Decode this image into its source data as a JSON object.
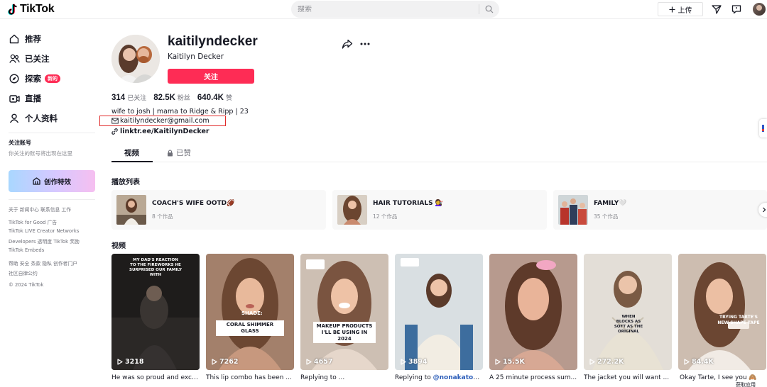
{
  "header": {
    "logo_text": "TikTok",
    "search_placeholder": "搜索",
    "upload_label": "上传"
  },
  "sidebar": {
    "nav": [
      {
        "label": "推荐",
        "icon": "home-icon"
      },
      {
        "label": "已关注",
        "icon": "following-icon"
      },
      {
        "label": "探索",
        "icon": "explore-icon",
        "badge": "新的"
      },
      {
        "label": "直播",
        "icon": "live-icon"
      },
      {
        "label": "个人资料",
        "icon": "profile-icon"
      }
    ],
    "following_title": "关注账号",
    "following_desc": "你关注的账号将出现在这里",
    "effects_label": "创作特效",
    "footer": [
      "关于  新闻中心  联系信息  工作",
      "TikTok for Good  广告",
      "TikTok LIVE Creator Networks",
      "Developers  透明度  TikTok 奖励",
      "TikTok Embeds",
      "帮助  安全  条款  隐私  创作者门户",
      "社区自律公约",
      "© 2024 TikTok"
    ]
  },
  "profile": {
    "username": "kaitilyndecker",
    "nickname": "Kaitilyn Decker",
    "follow_label": "关注",
    "stats": [
      {
        "value": "314",
        "label": "已关注"
      },
      {
        "value": "82.5K",
        "label": "粉丝"
      },
      {
        "value": "640.4K",
        "label": "赞"
      }
    ],
    "bio": "wife to josh | mama to Ridge & Ripp | 23",
    "email": "kaitilyndecker@gmail.com",
    "link": "linktr.ee/KaitilynDecker"
  },
  "tabs": {
    "videos": "视频",
    "liked": "已赞"
  },
  "playlists": {
    "title": "播放列表",
    "items": [
      {
        "title": "COACH'S WIFE OOTD🏈",
        "count": "8 个作品"
      },
      {
        "title": "HAIR TUTORIALS 💇‍♀️",
        "count": "12 个作品"
      },
      {
        "title": "FAMILY🤍",
        "count": "35 个作品"
      }
    ]
  },
  "videos": {
    "title": "视频",
    "items": [
      {
        "views": "3218",
        "caption": "He was so proud and exci...",
        "overlay": "MY DAD'S REACTION TO THE FIREWORKS HE SURPRISED OUR FAMILY WITH"
      },
      {
        "views": "7262",
        "caption": "This lip combo has been ...",
        "overlay_a": "SHADE:",
        "overlay": "CORAL SHIMMER GLASS"
      },
      {
        "views": "4657",
        "caption": "Replying to ...",
        "overlay": "MAKEUP PRODUCTS I'LL BE USING IN 2024"
      },
      {
        "views": "3894",
        "caption_prefix": "Replying to ",
        "mention": "@nonakatok",
        "caption_suffix": " ...",
        "overlay": ""
      },
      {
        "views": "15.5K",
        "caption": "A 25 minute process sum...",
        "overlay": ""
      },
      {
        "views": "272.2K",
        "caption": "The jacket you will want ...",
        "overlay": "WHEN BLOCKS AS SOFT AS THE ORIGINAL"
      },
      {
        "views": "84.4K",
        "caption": "Okay Tarte, I see you 🙈",
        "overlay": "TRYING TARTE'S NEW SHAPE TAPE"
      }
    ]
  },
  "get_app": "获取应用",
  "colors": {
    "brand_red": "#fe2c55",
    "text": "#161823",
    "muted": "#8a8b91",
    "annotation_box": "#e02a2a"
  }
}
